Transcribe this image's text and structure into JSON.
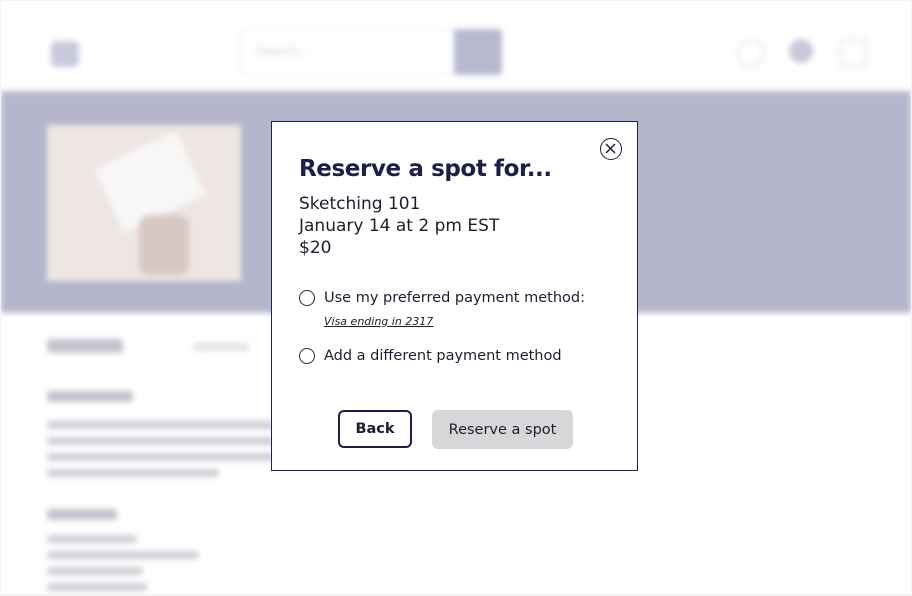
{
  "background": {
    "search_placeholder": "Search...",
    "hero_color": "#b5b6cb"
  },
  "modal": {
    "title": "Reserve a spot for...",
    "class_name": "Sketching 101",
    "datetime": "January 14 at 2 pm EST",
    "price": "$20",
    "options": [
      {
        "label": "Use my preferred payment method:",
        "selected": false,
        "sublink": "Visa ending in 2317"
      },
      {
        "label": "Add a different payment method",
        "selected": false
      }
    ],
    "back_label": "Back",
    "reserve_label": "Reserve a spot",
    "accent_color": "#1c1d4d",
    "close_icon": "close-circle-icon"
  }
}
